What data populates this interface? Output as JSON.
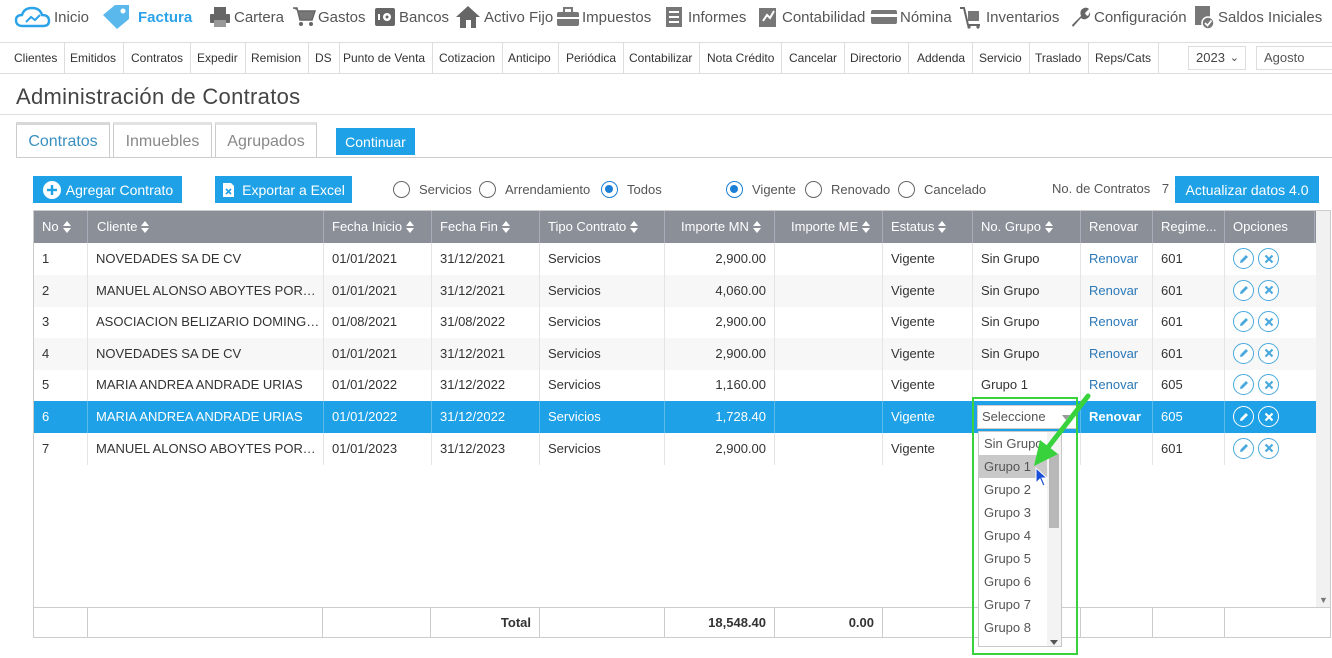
{
  "topnav": {
    "items": [
      {
        "label": "Inicio",
        "icon": "cloud-icon"
      },
      {
        "label": "Factura",
        "icon": "tag-icon",
        "active": true
      },
      {
        "label": "Cartera",
        "icon": "printer-icon"
      },
      {
        "label": "Gastos",
        "icon": "cart-icon"
      },
      {
        "label": "Bancos",
        "icon": "safe-icon"
      },
      {
        "label": "Activo Fijo",
        "icon": "house-icon"
      },
      {
        "label": "Impuestos",
        "icon": "briefcase-icon"
      },
      {
        "label": "Informes",
        "icon": "report-icon"
      },
      {
        "label": "Contabilidad",
        "icon": "ledger-icon"
      },
      {
        "label": "Nómina",
        "icon": "card-icon"
      },
      {
        "label": "Inventarios",
        "icon": "box-icon"
      },
      {
        "label": "Configuración",
        "icon": "wrench-icon"
      },
      {
        "label": "Saldos Iniciales",
        "icon": "check-doc-icon"
      }
    ]
  },
  "subnav": {
    "items": [
      "Clientes",
      "Emitidos",
      "Contratos",
      "Expedir",
      "Remision",
      "DS",
      "Punto de Venta",
      "Cotizacion",
      "Anticipo",
      "Periódica",
      "Contabilizar",
      "Nota Crédito",
      "Cancelar",
      "Directorio",
      "Addenda",
      "Servicio",
      "Traslado",
      "Reps/Cats"
    ],
    "year": "2023",
    "month": "Agosto"
  },
  "page": {
    "title": "Administración de Contratos"
  },
  "tabs": [
    "Contratos",
    "Inmuebles",
    "Agrupados"
  ],
  "continue_label": "Continuar",
  "toolbar": {
    "add_label": "Agregar Contrato",
    "export_label": "Exportar a Excel",
    "type_filters": [
      {
        "label": "Servicios",
        "checked": false
      },
      {
        "label": "Arrendamiento",
        "checked": false
      },
      {
        "label": "Todos",
        "checked": true
      }
    ],
    "status_filters": [
      {
        "label": "Vigente",
        "checked": true
      },
      {
        "label": "Renovado",
        "checked": false
      },
      {
        "label": "Cancelado",
        "checked": false
      }
    ],
    "count_label": "No. de Contratos",
    "count_value": "7",
    "update_label": "Actualizar datos 4.0"
  },
  "table": {
    "headers": [
      "No",
      "Cliente",
      "Fecha Inicio",
      "Fecha Fin",
      "Tipo Contrato",
      "Importe MN",
      "Importe ME",
      "Estatus",
      "No. Grupo",
      "Renovar",
      "Regime...",
      "Opciones"
    ],
    "rows": [
      {
        "no": "1",
        "cliente": "NOVEDADES SA DE CV",
        "inicio": "01/01/2021",
        "fin": "31/12/2021",
        "tipo": "Servicios",
        "mn": "2,900.00",
        "me": "",
        "estatus": "Vigente",
        "grupo": "Sin Grupo",
        "renovar": "Renovar",
        "regimen": "601"
      },
      {
        "no": "2",
        "cliente": "MANUEL ALONSO ABOYTES PORTILLO",
        "inicio": "01/01/2021",
        "fin": "31/12/2021",
        "tipo": "Servicios",
        "mn": "4,060.00",
        "me": "",
        "estatus": "Vigente",
        "grupo": "Sin Grupo",
        "renovar": "Renovar",
        "regimen": "601"
      },
      {
        "no": "3",
        "cliente": "ASOCIACION BELIZARIO DOMINGUE...",
        "inicio": "01/08/2021",
        "fin": "31/08/2022",
        "tipo": "Servicios",
        "mn": "2,900.00",
        "me": "",
        "estatus": "Vigente",
        "grupo": "Sin Grupo",
        "renovar": "Renovar",
        "regimen": "601"
      },
      {
        "no": "4",
        "cliente": "NOVEDADES SA DE CV",
        "inicio": "01/01/2021",
        "fin": "31/12/2021",
        "tipo": "Servicios",
        "mn": "2,900.00",
        "me": "",
        "estatus": "Vigente",
        "grupo": "Sin Grupo",
        "renovar": "Renovar",
        "regimen": "601"
      },
      {
        "no": "5",
        "cliente": "MARIA ANDREA ANDRADE URIAS",
        "inicio": "01/01/2022",
        "fin": "31/12/2022",
        "tipo": "Servicios",
        "mn": "1,160.00",
        "me": "",
        "estatus": "Vigente",
        "grupo": "Grupo 1",
        "renovar": "Renovar",
        "regimen": "605"
      },
      {
        "no": "6",
        "cliente": "MARIA ANDREA ANDRADE URIAS",
        "inicio": "01/01/2022",
        "fin": "31/12/2022",
        "tipo": "Servicios",
        "mn": "1,728.40",
        "me": "",
        "estatus": "Vigente",
        "grupo": "",
        "renovar": "Renovar",
        "regimen": "605",
        "selected": true
      },
      {
        "no": "7",
        "cliente": "MANUEL ALONSO ABOYTES PORTILLO",
        "inicio": "01/01/2023",
        "fin": "31/12/2023",
        "tipo": "Servicios",
        "mn": "2,900.00",
        "me": "",
        "estatus": "Vigente",
        "grupo": "",
        "renovar": "",
        "regimen": "601"
      }
    ],
    "footer": {
      "label": "Total",
      "mn": "18,548.40",
      "me": "0.00"
    }
  },
  "group_select": {
    "placeholder": "Seleccione",
    "options": [
      "Sin Grupo",
      "Grupo 1",
      "Grupo 2",
      "Grupo 3",
      "Grupo 4",
      "Grupo 5",
      "Grupo 6",
      "Grupo 7",
      "Grupo 8"
    ],
    "highlighted": "Grupo 1"
  },
  "colors": {
    "accent": "#1ea1e6",
    "header": "#8a8f98",
    "annotation": "#38d23c",
    "link": "#2a78b8"
  }
}
